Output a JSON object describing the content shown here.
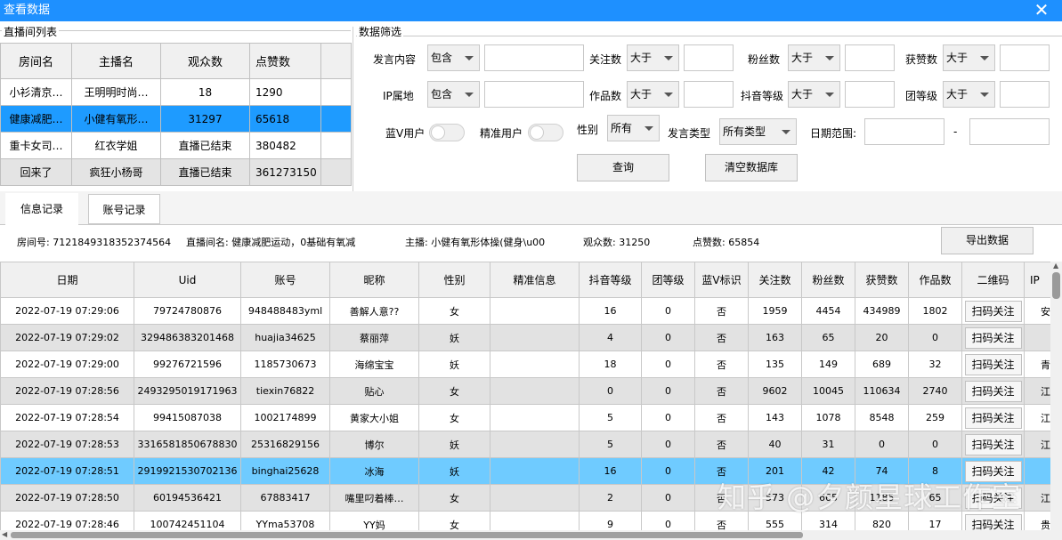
{
  "window": {
    "title": "查看数据",
    "close": "✕"
  },
  "live_list": {
    "group_title": "直播间列表",
    "headers": [
      "房间名",
      "主播名",
      "观众数",
      "点赞数"
    ],
    "rows": [
      [
        "小衫清京…",
        "王明明时尚…",
        "18",
        "1290"
      ],
      [
        "健康减肥…",
        "小健有氧形…",
        "31297",
        "65618"
      ],
      [
        "重卡女司…",
        "红衣学姐",
        "直播已结束",
        "380482"
      ],
      [
        "回来了",
        "疯狂小杨哥",
        "直播已结束",
        "361273150"
      ]
    ],
    "selected_row": 1
  },
  "filter": {
    "group_title": "数据筛选",
    "content_label": "发言内容",
    "content_op": "包含",
    "follow_label": "关注数",
    "follow_op": "大于",
    "fans_label": "粉丝数",
    "fans_op": "大于",
    "likes_label": "获赞数",
    "likes_op": "大于",
    "ip_label": "IP属地",
    "ip_op": "包含",
    "works_label": "作品数",
    "works_op": "大于",
    "dy_level_label": "抖音等级",
    "dy_level_op": "大于",
    "group_level_label": "团等级",
    "group_level_op": "大于",
    "bluev_label": "蓝V用户",
    "precise_label": "精准用户",
    "gender_label": "性别",
    "gender_value": "所有",
    "speech_type_label": "发言类型",
    "speech_type_value": "所有类型",
    "date_label": "日期范围:",
    "date_sep": "-",
    "query_button": "查询",
    "clear_button": "清空数据库"
  },
  "tabs": [
    "信息记录",
    "账号记录"
  ],
  "info": {
    "room_id": "房间号: 7121849318352374564",
    "room_name": "直播间名: 健康减肥运动，0基础有氧减",
    "anchor": "主播: 小健有氧形体操(健身\\u00",
    "viewers": "观众数: 31250",
    "likes": "点赞数: 65854",
    "export_button": "导出数据"
  },
  "records": {
    "headers": [
      "日期",
      "Uid",
      "账号",
      "昵称",
      "性别",
      "精准信息",
      "抖音等级",
      "团等级",
      "蓝V标识",
      "关注数",
      "粉丝数",
      "获赞数",
      "作品数",
      "二维码",
      "IP"
    ],
    "qr_label": "扫码关注",
    "selected_row": 6,
    "rows": [
      [
        "2022-07-19 07:29:06",
        "79724780876",
        "948488483yml",
        "善解人意??",
        "女",
        "",
        "16",
        "0",
        "否",
        "1959",
        "4454",
        "434989",
        "1802",
        "安"
      ],
      [
        "2022-07-19 07:29:02",
        "329486383201468",
        "huajia34625",
        "蔡丽萍",
        "妖",
        "",
        "4",
        "0",
        "否",
        "163",
        "65",
        "20",
        "0",
        ""
      ],
      [
        "2022-07-19 07:29:00",
        "99276721596",
        "1185730673",
        "海绵宝宝",
        "妖",
        "",
        "18",
        "0",
        "否",
        "135",
        "149",
        "689",
        "32",
        "青"
      ],
      [
        "2022-07-19 07:28:56",
        "2493295019171963",
        "tiexin76822",
        "贴心",
        "女",
        "",
        "0",
        "0",
        "否",
        "9602",
        "10045",
        "110634",
        "2740",
        "江"
      ],
      [
        "2022-07-19 07:28:54",
        "99415087038",
        "1002174899",
        "黄家大小姐",
        "女",
        "",
        "5",
        "0",
        "否",
        "143",
        "1078",
        "8548",
        "259",
        "江"
      ],
      [
        "2022-07-19 07:28:53",
        "3316581850678830",
        "25316829156",
        "博尔",
        "妖",
        "",
        "5",
        "0",
        "否",
        "40",
        "31",
        "0",
        "0",
        "江"
      ],
      [
        "2022-07-19 07:28:51",
        "2919921530702136",
        "binghai25628",
        "冰海",
        "妖",
        "",
        "16",
        "0",
        "否",
        "201",
        "42",
        "74",
        "8",
        ""
      ],
      [
        "2022-07-19 07:28:50",
        "60194536421",
        "67883417",
        "嘴里叼着棒…",
        "女",
        "",
        "2",
        "0",
        "否",
        "573",
        "665",
        "1185",
        "65",
        "江"
      ],
      [
        "2022-07-19 07:28:46",
        "100742451104",
        "YYma53708",
        "YY妈",
        "女",
        "",
        "9",
        "0",
        "否",
        "555",
        "314",
        "820",
        "17",
        "贵"
      ]
    ]
  },
  "watermark": "知乎 @夕颜星球工作室"
}
